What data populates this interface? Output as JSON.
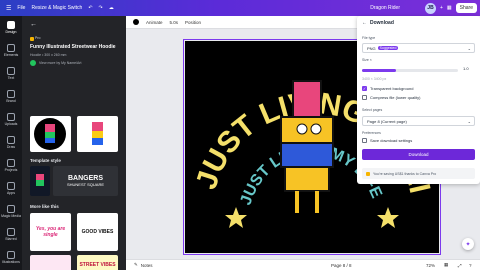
{
  "topbar": {
    "file": "File",
    "resize": "Resize & Magic Switch",
    "title": "Dragon Rider",
    "avatar": "JB",
    "share": "Share"
  },
  "rail": [
    "Design",
    "Elements",
    "Text",
    "Brand",
    "Uploads",
    "Draw",
    "Projects",
    "Apps",
    "Magic Media",
    "Starred",
    "Illustrations"
  ],
  "panel": {
    "pro": "Pro",
    "title": "Funny Illustrated Streetwear Hoodie",
    "size": "Hoodie • 300 x 260 mm",
    "author": "View more by My Name/Art",
    "apply": "Apply both pages",
    "template_style": "Template style",
    "style_text1": "BANGERS",
    "style_text2": "SHUNEST SQUARE",
    "more": "More like this",
    "thumb_texts": [
      "Yes, you are single",
      "GOOD VIBES",
      "STREET VIBES"
    ]
  },
  "toolbar": {
    "animate": "Animate",
    "duration": "5.0s",
    "position": "Position"
  },
  "design": {
    "arc_text": "JUST LIVING MY LIFE",
    "inner_text": "JUST LIVING MY LIFE"
  },
  "download": {
    "title": "Download",
    "file_type_label": "File type",
    "file_type": "PNG",
    "suggested": "Suggested",
    "size_label": "Size ×",
    "size_value": "1.0",
    "size_hint": "3400 × 3400 px",
    "size_level": 0.35,
    "transparent": "Transparent background",
    "compress": "Compress file (lower quality)",
    "select_pages_label": "Select pages",
    "pages_value": "Page 8 (Current page)",
    "preferences_label": "Preferences",
    "save_settings": "Save download settings",
    "button": "Download",
    "note": "You're saving US$1 thanks to Canva Pro"
  },
  "footer": {
    "notes": "Notes",
    "page": "Page 8 / 8",
    "zoom": "72%"
  }
}
